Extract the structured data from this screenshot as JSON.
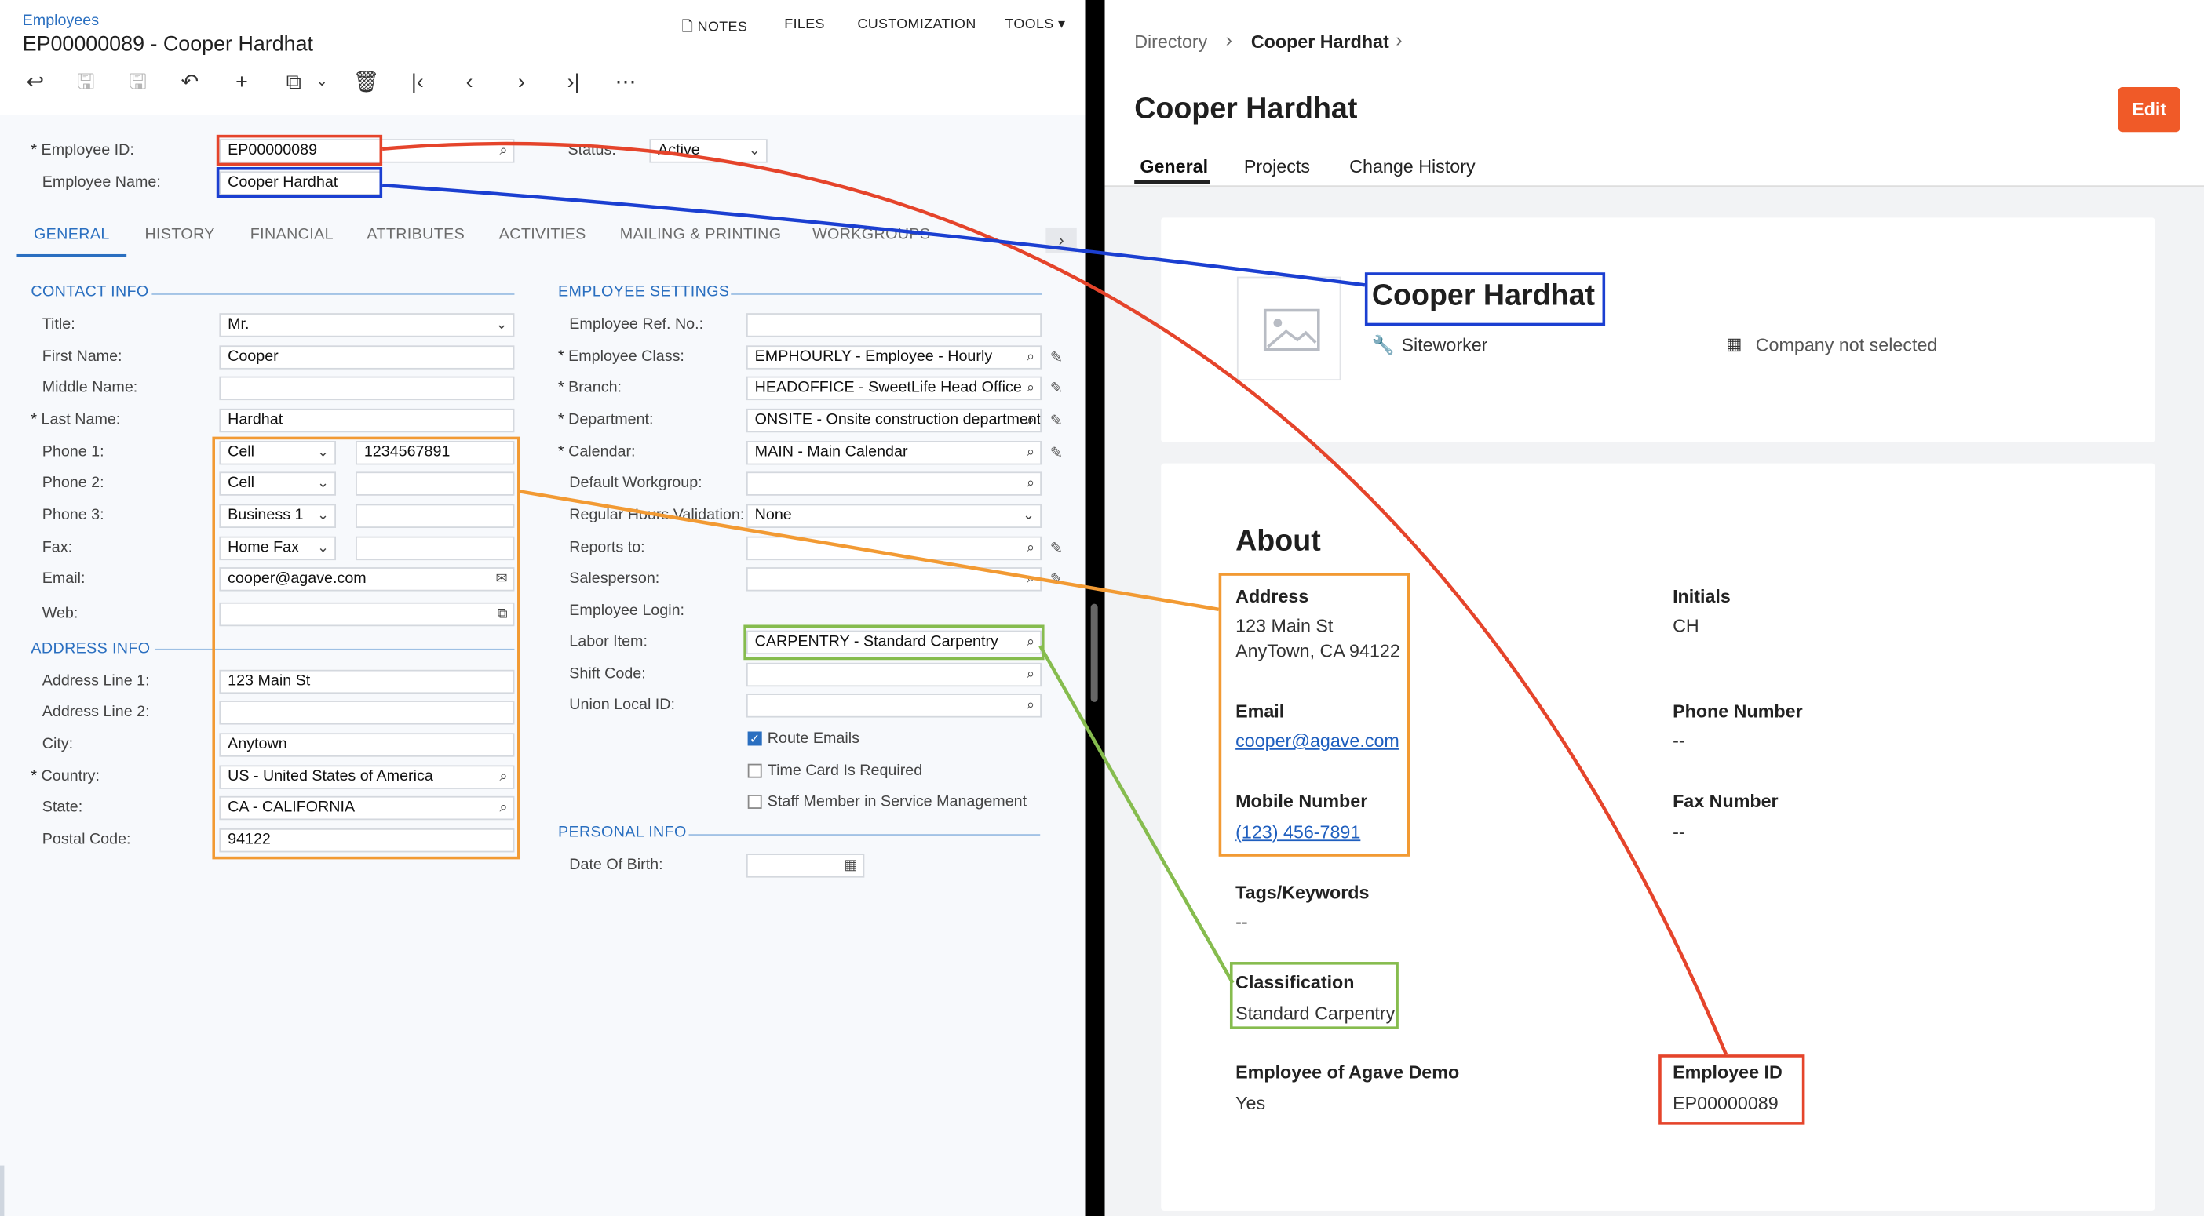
{
  "left": {
    "breadcrumb": "Employees",
    "title": "EP00000089 - Cooper Hardhat",
    "top_actions": [
      "NOTES",
      "FILES",
      "CUSTOMIZATION",
      "TOOLS"
    ],
    "header_fields": {
      "employee_id_label": "Employee ID:",
      "employee_id": "EP00000089",
      "status_label": "Status:",
      "status": "Active",
      "employee_name_label": "Employee Name:",
      "employee_name": "Cooper Hardhat"
    },
    "tabs": [
      "GENERAL",
      "HISTORY",
      "FINANCIAL",
      "ATTRIBUTES",
      "ACTIVITIES",
      "MAILING & PRINTING",
      "WORKGROUPS"
    ],
    "contact_info": {
      "heading": "CONTACT INFO",
      "title_label": "Title:",
      "title": "Mr.",
      "first_name_label": "First Name:",
      "first_name": "Cooper",
      "middle_name_label": "Middle Name:",
      "middle_name": "",
      "last_name_label": "Last Name:",
      "last_name": "Hardhat",
      "phone1_label": "Phone 1:",
      "phone1_type": "Cell",
      "phone1": "1234567891",
      "phone2_label": "Phone 2:",
      "phone2_type": "Cell",
      "phone2": "",
      "phone3_label": "Phone 3:",
      "phone3_type": "Business 1",
      "phone3": "",
      "fax_label": "Fax:",
      "fax_type": "Home Fax",
      "fax": "",
      "email_label": "Email:",
      "email": "cooper@agave.com",
      "web_label": "Web:",
      "web": ""
    },
    "address_info": {
      "heading": "ADDRESS INFO",
      "line1_label": "Address Line 1:",
      "line1": "123 Main St",
      "line2_label": "Address Line 2:",
      "line2": "",
      "city_label": "City:",
      "city": "Anytown",
      "country_label": "Country:",
      "country": "US - United States of America",
      "state_label": "State:",
      "state": "CA - CALIFORNIA",
      "postal_label": "Postal Code:",
      "postal": "94122"
    },
    "employee_settings": {
      "heading": "EMPLOYEE SETTINGS",
      "ref_label": "Employee Ref. No.:",
      "ref": "",
      "class_label": "Employee Class:",
      "class": "EMPHOURLY - Employee - Hourly",
      "branch_label": "Branch:",
      "branch": "HEADOFFICE - SweetLife Head Office",
      "dept_label": "Department:",
      "dept": "ONSITE - Onsite construction department",
      "calendar_label": "Calendar:",
      "calendar": "MAIN - Main Calendar",
      "workgroup_label": "Default Workgroup:",
      "workgroup": "",
      "rhv_label": "Regular Hours Validation:",
      "rhv": "None",
      "reports_label": "Reports to:",
      "reports": "",
      "sales_label": "Salesperson:",
      "sales": "",
      "login_label": "Employee Login:",
      "labor_label": "Labor Item:",
      "labor": "CARPENTRY - Standard Carpentry",
      "shift_label": "Shift Code:",
      "shift": "",
      "union_label": "Union Local ID:",
      "union": "",
      "route_emails": "Route Emails",
      "timecard": "Time Card Is Required",
      "staff": "Staff Member in Service Management"
    },
    "personal_info": {
      "heading": "PERSONAL INFO",
      "dob_label": "Date Of Birth:",
      "dob": ""
    }
  },
  "right": {
    "breadcrumb": [
      "Directory",
      "Cooper Hardhat"
    ],
    "page_title": "Cooper Hardhat",
    "edit_label": "Edit",
    "tabs": [
      "General",
      "Projects",
      "Change History"
    ],
    "profile": {
      "name": "Cooper Hardhat",
      "role": "Siteworker",
      "company": "Company not selected"
    },
    "about": {
      "heading": "About",
      "address_label": "Address",
      "address_line1": "123 Main St",
      "address_line2": "AnyTown, CA 94122",
      "initials_label": "Initials",
      "initials": "CH",
      "email_label": "Email",
      "email": "cooper@agave.com",
      "phone_label": "Phone Number",
      "phone": "--",
      "mobile_label": "Mobile Number",
      "mobile": "(123) 456-7891",
      "fax_label": "Fax Number",
      "fax": "--",
      "tags_label": "Tags/Keywords",
      "tags": "--",
      "classification_label": "Classification",
      "classification": "Standard Carpentry",
      "agave_label": "Employee of Agave Demo",
      "agave": "Yes",
      "empid_label": "Employee ID",
      "empid": "EP00000089"
    }
  },
  "colors": {
    "red": "#e5442b",
    "blue": "#1b3fd1",
    "orange": "#f29a33",
    "green": "#86bc4e",
    "edit_button": "#f05a28",
    "link": "#2a6fc0"
  }
}
